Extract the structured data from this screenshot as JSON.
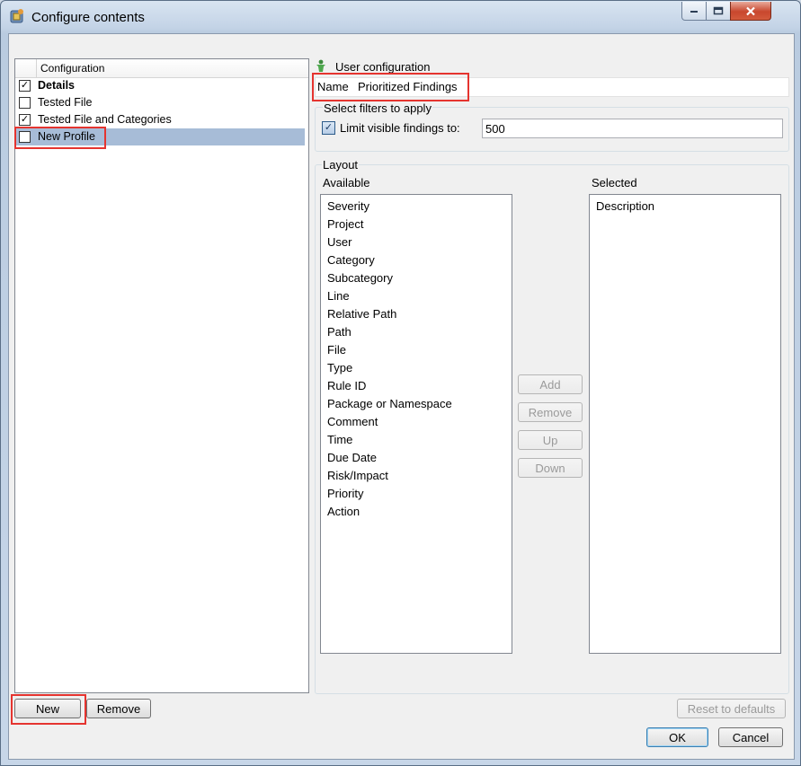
{
  "window": {
    "title": "Configure contents"
  },
  "tree": {
    "column_header": "Configuration",
    "items": [
      {
        "label": "Details",
        "checked": true,
        "bold": true,
        "selected": false
      },
      {
        "label": "Tested File",
        "checked": false,
        "bold": false,
        "selected": false
      },
      {
        "label": "Tested File and Categories",
        "checked": true,
        "bold": false,
        "selected": false
      },
      {
        "label": "New Profile",
        "checked": false,
        "bold": false,
        "selected": true
      }
    ]
  },
  "buttons": {
    "new": "New",
    "remove_profile": "Remove",
    "reset": "Reset to defaults",
    "ok": "OK",
    "cancel": "Cancel",
    "add": "Add",
    "remove_column": "Remove",
    "up": "Up",
    "down": "Down"
  },
  "user_config": {
    "heading": "User configuration",
    "name_label": "Name",
    "name_value": "Prioritized Findings"
  },
  "filters": {
    "heading": "Select filters to apply",
    "limit_label": "Limit visible findings to:",
    "limit_checked": true,
    "limit_value": "500"
  },
  "layout": {
    "heading": "Layout",
    "available_label": "Available",
    "selected_label": "Selected",
    "available": [
      "Severity",
      "Project",
      "User",
      "Category",
      "Subcategory",
      "Line",
      "Relative Path",
      "Path",
      "File",
      "Type",
      "Rule ID",
      "Package or Namespace",
      "Comment",
      "Time",
      "Due Date",
      "Risk/Impact",
      "Priority",
      "Action"
    ],
    "selected": [
      "Description"
    ]
  },
  "colors": {
    "highlight": "#e5342f",
    "selection": "#a7bcd7"
  }
}
